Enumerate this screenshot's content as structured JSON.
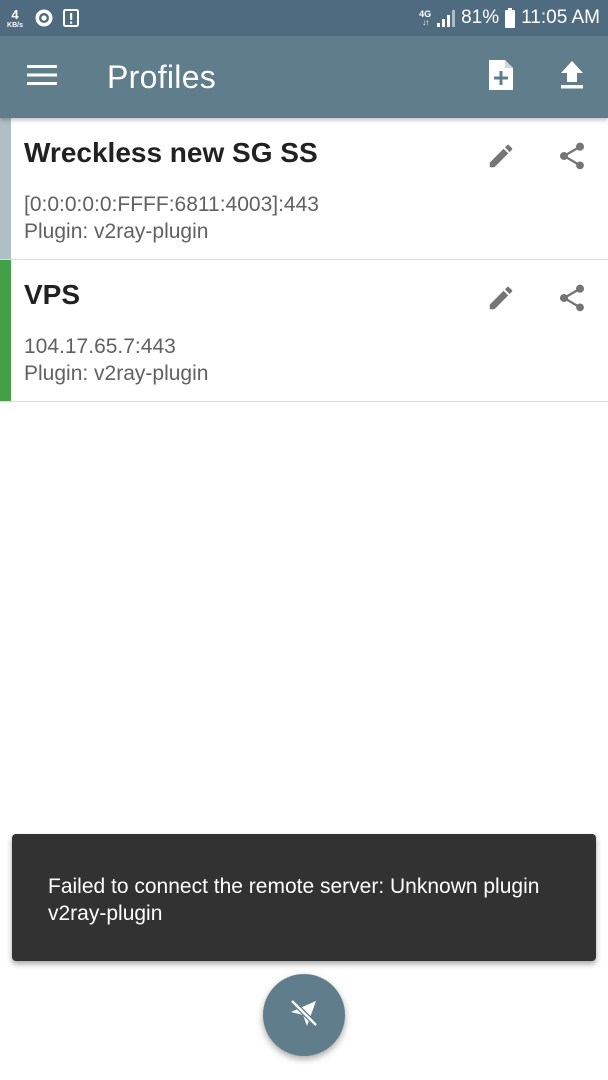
{
  "status_bar": {
    "net_speed_value": "4",
    "net_speed_unit": "KB/s",
    "network_type": "4G",
    "network_arrows": "↓↑",
    "battery_percent": "81%",
    "time": "11:05 AM",
    "icons": [
      "vpn-key-icon",
      "alert-icon",
      "signal-icon",
      "battery-icon"
    ]
  },
  "app_bar": {
    "title": "Profiles",
    "icons": [
      "menu-icon",
      "add-file-icon",
      "upload-icon"
    ],
    "background": "#607d8b"
  },
  "profiles": [
    {
      "name": "Wreckless new SG SS",
      "address": "[0:0:0:0:0:FFFF:6811:4003]:443",
      "plugin": "Plugin: v2ray-plugin",
      "accent_color": "#b0bec5",
      "selected": false
    },
    {
      "name": "VPS",
      "address": "104.17.65.7:443",
      "plugin": "Plugin: v2ray-plugin",
      "accent_color": "#43a047",
      "selected": true
    }
  ],
  "profile_actions": [
    "edit-icon",
    "share-icon"
  ],
  "snackbar": {
    "message": "Failed to connect the remote server: Unknown plugin v2ray-plugin"
  },
  "fab": {
    "icon": "plane-off-icon",
    "background": "#607d8b"
  }
}
